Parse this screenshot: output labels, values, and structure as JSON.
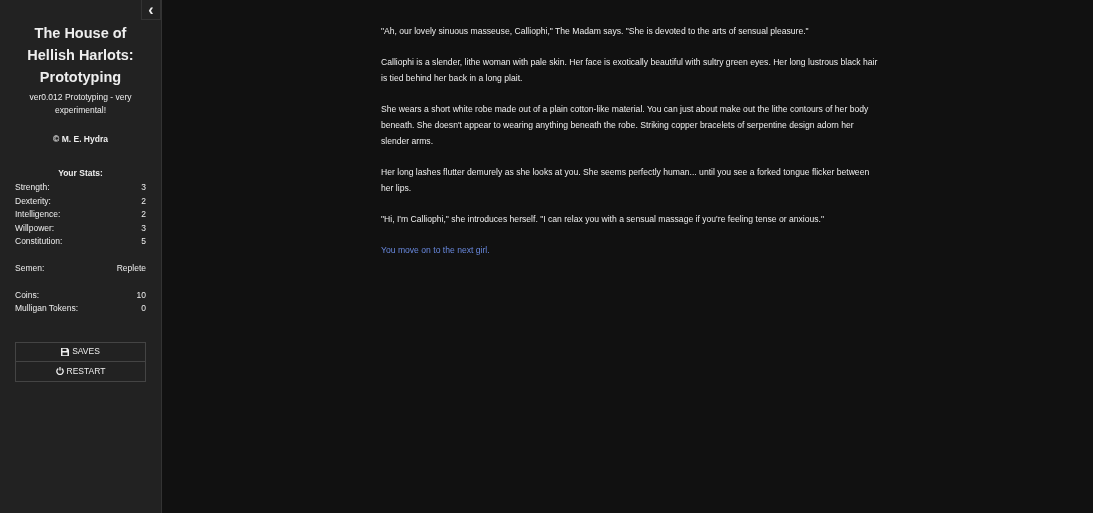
{
  "sidebar": {
    "collapse_button": "‹",
    "title": "The House of Hellish Harlots: Prototyping",
    "subtitle": "ver0.012 Prototyping - very experimental!",
    "author": "© M. E. Hydra",
    "stats_heading": "Your Stats:",
    "stat_groups": [
      [
        {
          "label": "Strength:",
          "value": "3"
        },
        {
          "label": "Dexterity:",
          "value": "2"
        },
        {
          "label": "Intelligence:",
          "value": "2"
        },
        {
          "label": "Willpower:",
          "value": "3"
        },
        {
          "label": "Constitution:",
          "value": "5"
        }
      ],
      [
        {
          "label": "Semen:",
          "value": "Replete"
        }
      ],
      [
        {
          "label": "Coins:",
          "value": "10"
        },
        {
          "label": "Mulligan Tokens:",
          "value": "0"
        }
      ]
    ],
    "menu": [
      {
        "kind": "saves",
        "label": "SAVES"
      },
      {
        "kind": "restart",
        "label": "RESTART"
      }
    ]
  },
  "passage": {
    "paragraphs": [
      "\"Ah, our lovely sinuous masseuse, Calliophi,\" The Madam says. \"She is devoted to the arts of sensual pleasure.\"",
      "Calliophi is a slender, lithe woman with pale skin. Her face is exotically beautiful with sultry green eyes. Her long lustrous black hair is tied behind her back in a long plait.",
      "She wears a short white robe made out of a plain cotton-like material. You can just about make out the lithe contours of her body beneath. She doesn't appear to wearing anything beneath the robe. Striking copper bracelets of serpentine design adorn her slender arms.",
      "Her long lashes flutter demurely as she looks at you. She seems perfectly human... until you see a forked tongue flicker between her lips.",
      "\"Hi, I'm Calliophi,\" she introduces herself. \"I can relax you with a sensual massage if you're feeling tense or anxious.\""
    ],
    "link": "You move on to the next girl."
  }
}
